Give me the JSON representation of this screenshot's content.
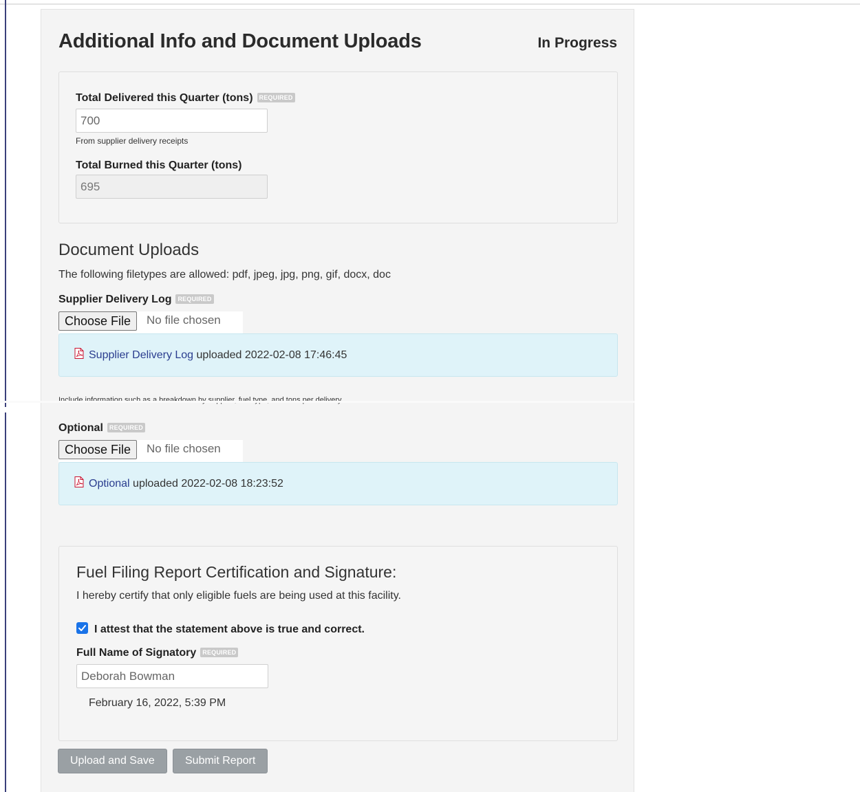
{
  "header": {
    "title": "Additional Info and Document Uploads",
    "status": "In Progress"
  },
  "quarter": {
    "delivered_label": "Total Delivered this Quarter (tons)",
    "required_badge": "REQUIRED",
    "delivered_value": "700",
    "delivered_help": "From supplier delivery receipts",
    "burned_label": "Total Burned this Quarter (tons)",
    "burned_value": "695"
  },
  "uploads": {
    "heading": "Document Uploads",
    "filetypes_text": "The following filetypes are allowed: pdf, jpeg, jpg, png, gif, docx, doc",
    "choose_file_label": "Choose File",
    "no_file_text": "No file chosen",
    "supplier_log": {
      "label": "Supplier Delivery Log",
      "required_badge": "REQUIRED",
      "file_link": "Supplier Delivery Log",
      "uploaded_text": " uploaded 2022-02-08 17:46:45",
      "help": "Include information such as a breakdown by supplier, fuel type, and tons per delivery"
    },
    "optional": {
      "label": "Optional",
      "required_badge": "REQUIRED",
      "file_link": "Optional",
      "uploaded_text": " uploaded 2022-02-08 18:23:52"
    }
  },
  "certification": {
    "heading": "Fuel Filing Report Certification and Signature:",
    "statement": "I hereby certify that only eligible fuels are being used at this facility.",
    "attest_label": "I attest that the statement above is true and correct.",
    "attest_checked": true,
    "signatory_label": "Full Name of Signatory",
    "required_badge": "REQUIRED",
    "signatory_value": "Deborah Bowman",
    "timestamp": "February 16, 2022, 5:39 PM"
  },
  "actions": {
    "upload_save_label": "Upload and Save",
    "submit_label": "Submit Report"
  },
  "icons": {
    "pdf": "pdf-file-icon",
    "check": "checkmark-icon"
  },
  "colors": {
    "link": "#2a3d8f",
    "upload_box_bg": "#dff3f9",
    "checkbox": "#1a73e8",
    "button_bg": "#9aa0a4"
  }
}
